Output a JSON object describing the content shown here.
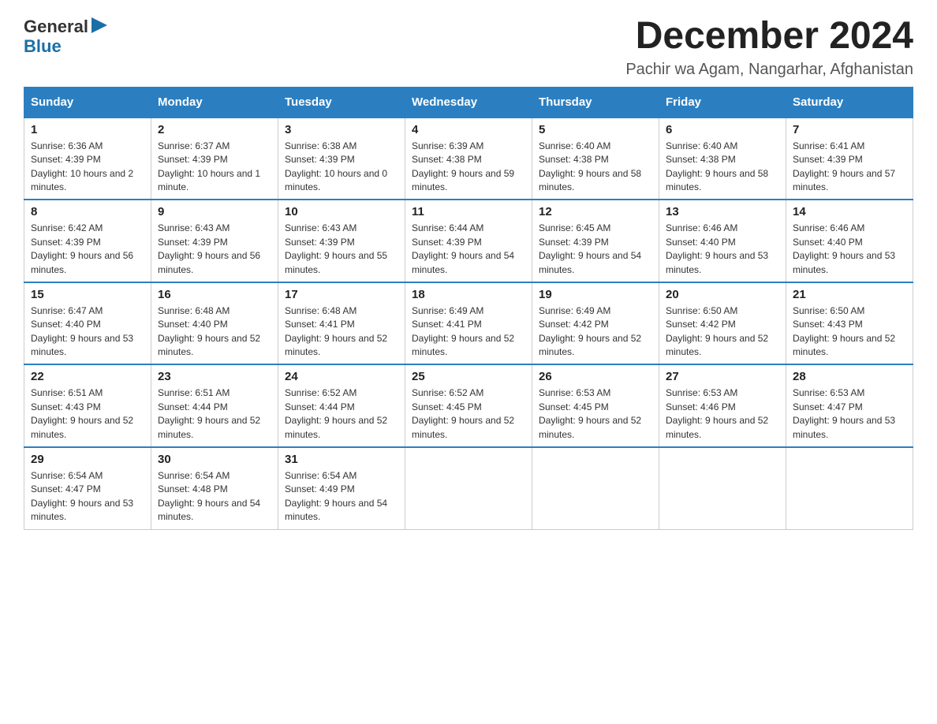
{
  "logo": {
    "text_general": "General",
    "text_blue": "Blue"
  },
  "header": {
    "month_year": "December 2024",
    "location": "Pachir wa Agam, Nangarhar, Afghanistan"
  },
  "days_of_week": [
    "Sunday",
    "Monday",
    "Tuesday",
    "Wednesday",
    "Thursday",
    "Friday",
    "Saturday"
  ],
  "weeks": [
    [
      {
        "day": "1",
        "sunrise": "6:36 AM",
        "sunset": "4:39 PM",
        "daylight": "10 hours and 2 minutes."
      },
      {
        "day": "2",
        "sunrise": "6:37 AM",
        "sunset": "4:39 PM",
        "daylight": "10 hours and 1 minute."
      },
      {
        "day": "3",
        "sunrise": "6:38 AM",
        "sunset": "4:39 PM",
        "daylight": "10 hours and 0 minutes."
      },
      {
        "day": "4",
        "sunrise": "6:39 AM",
        "sunset": "4:38 PM",
        "daylight": "9 hours and 59 minutes."
      },
      {
        "day": "5",
        "sunrise": "6:40 AM",
        "sunset": "4:38 PM",
        "daylight": "9 hours and 58 minutes."
      },
      {
        "day": "6",
        "sunrise": "6:40 AM",
        "sunset": "4:38 PM",
        "daylight": "9 hours and 58 minutes."
      },
      {
        "day": "7",
        "sunrise": "6:41 AM",
        "sunset": "4:39 PM",
        "daylight": "9 hours and 57 minutes."
      }
    ],
    [
      {
        "day": "8",
        "sunrise": "6:42 AM",
        "sunset": "4:39 PM",
        "daylight": "9 hours and 56 minutes."
      },
      {
        "day": "9",
        "sunrise": "6:43 AM",
        "sunset": "4:39 PM",
        "daylight": "9 hours and 56 minutes."
      },
      {
        "day": "10",
        "sunrise": "6:43 AM",
        "sunset": "4:39 PM",
        "daylight": "9 hours and 55 minutes."
      },
      {
        "day": "11",
        "sunrise": "6:44 AM",
        "sunset": "4:39 PM",
        "daylight": "9 hours and 54 minutes."
      },
      {
        "day": "12",
        "sunrise": "6:45 AM",
        "sunset": "4:39 PM",
        "daylight": "9 hours and 54 minutes."
      },
      {
        "day": "13",
        "sunrise": "6:46 AM",
        "sunset": "4:40 PM",
        "daylight": "9 hours and 53 minutes."
      },
      {
        "day": "14",
        "sunrise": "6:46 AM",
        "sunset": "4:40 PM",
        "daylight": "9 hours and 53 minutes."
      }
    ],
    [
      {
        "day": "15",
        "sunrise": "6:47 AM",
        "sunset": "4:40 PM",
        "daylight": "9 hours and 53 minutes."
      },
      {
        "day": "16",
        "sunrise": "6:48 AM",
        "sunset": "4:40 PM",
        "daylight": "9 hours and 52 minutes."
      },
      {
        "day": "17",
        "sunrise": "6:48 AM",
        "sunset": "4:41 PM",
        "daylight": "9 hours and 52 minutes."
      },
      {
        "day": "18",
        "sunrise": "6:49 AM",
        "sunset": "4:41 PM",
        "daylight": "9 hours and 52 minutes."
      },
      {
        "day": "19",
        "sunrise": "6:49 AM",
        "sunset": "4:42 PM",
        "daylight": "9 hours and 52 minutes."
      },
      {
        "day": "20",
        "sunrise": "6:50 AM",
        "sunset": "4:42 PM",
        "daylight": "9 hours and 52 minutes."
      },
      {
        "day": "21",
        "sunrise": "6:50 AM",
        "sunset": "4:43 PM",
        "daylight": "9 hours and 52 minutes."
      }
    ],
    [
      {
        "day": "22",
        "sunrise": "6:51 AM",
        "sunset": "4:43 PM",
        "daylight": "9 hours and 52 minutes."
      },
      {
        "day": "23",
        "sunrise": "6:51 AM",
        "sunset": "4:44 PM",
        "daylight": "9 hours and 52 minutes."
      },
      {
        "day": "24",
        "sunrise": "6:52 AM",
        "sunset": "4:44 PM",
        "daylight": "9 hours and 52 minutes."
      },
      {
        "day": "25",
        "sunrise": "6:52 AM",
        "sunset": "4:45 PM",
        "daylight": "9 hours and 52 minutes."
      },
      {
        "day": "26",
        "sunrise": "6:53 AM",
        "sunset": "4:45 PM",
        "daylight": "9 hours and 52 minutes."
      },
      {
        "day": "27",
        "sunrise": "6:53 AM",
        "sunset": "4:46 PM",
        "daylight": "9 hours and 52 minutes."
      },
      {
        "day": "28",
        "sunrise": "6:53 AM",
        "sunset": "4:47 PM",
        "daylight": "9 hours and 53 minutes."
      }
    ],
    [
      {
        "day": "29",
        "sunrise": "6:54 AM",
        "sunset": "4:47 PM",
        "daylight": "9 hours and 53 minutes."
      },
      {
        "day": "30",
        "sunrise": "6:54 AM",
        "sunset": "4:48 PM",
        "daylight": "9 hours and 54 minutes."
      },
      {
        "day": "31",
        "sunrise": "6:54 AM",
        "sunset": "4:49 PM",
        "daylight": "9 hours and 54 minutes."
      },
      null,
      null,
      null,
      null
    ]
  ]
}
